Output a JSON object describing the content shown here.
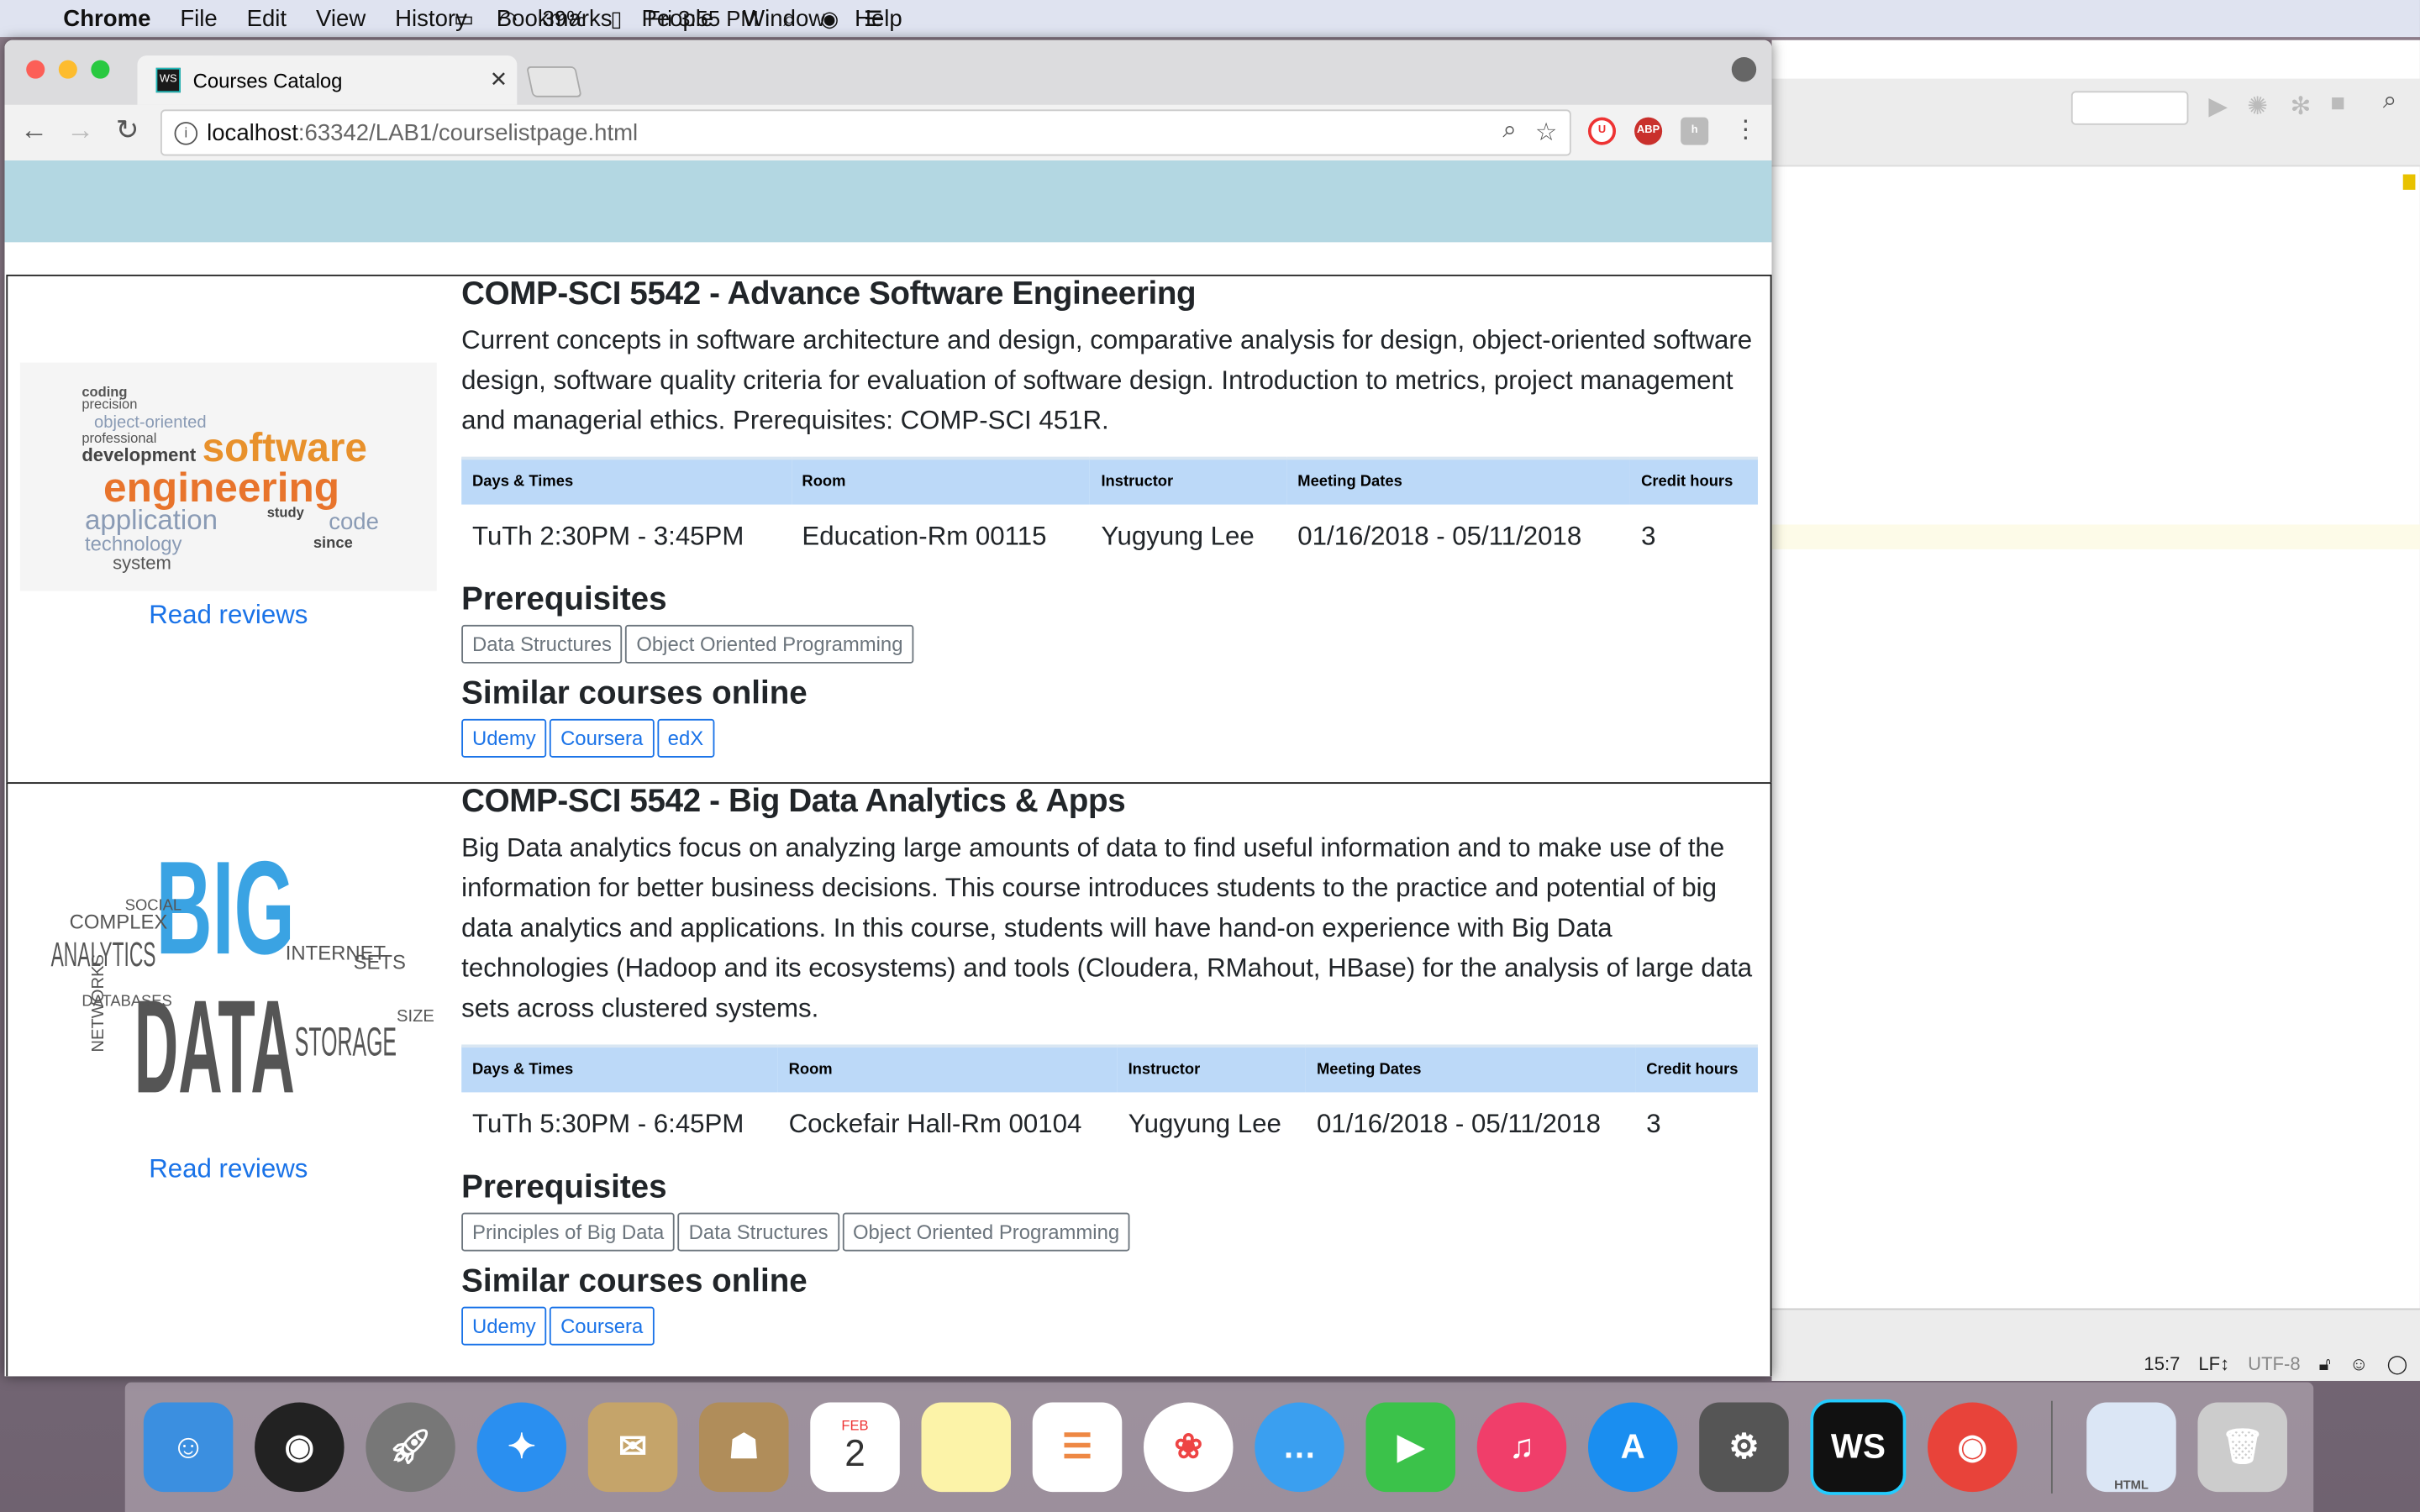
{
  "menubar": {
    "app": "Chrome",
    "items": [
      "File",
      "Edit",
      "View",
      "History",
      "Bookmarks",
      "People",
      "Window",
      "Help"
    ],
    "battery": "39%",
    "clock": "Fri 3:55 PM"
  },
  "browser": {
    "tab_title": "Courses Catalog",
    "url_host": "localhost",
    "url_path": ":63342/LAB1/courselistpage.html",
    "ext_abp": "ABP"
  },
  "courses": [
    {
      "title": "COMP-SCI 5542 - Advance Software Engineering",
      "description": "Current concepts in software architecture and design, comparative analysis for design, object-oriented software design, software quality criteria for evaluation of software design. Introduction to metrics, project management and managerial ethics. Prerequisites: COMP-SCI 451R.",
      "read_reviews": "Read reviews",
      "headers": [
        "Days & Times",
        "Room",
        "Instructor",
        "Meeting Dates",
        "Credit hours"
      ],
      "row": [
        "TuTh 2:30PM - 3:45PM",
        "Education-Rm 00115",
        "Yugyung Lee",
        "01/16/2018 - 05/11/2018",
        "3"
      ],
      "prereq_label": "Prerequisites",
      "prereqs": [
        "Data Structures",
        "Object Oriented Programming"
      ],
      "similar_label": "Similar courses online",
      "similar": [
        "Udemy",
        "Coursera",
        "edX"
      ],
      "image_words": [
        "software",
        "engineering",
        "application",
        "development",
        "technology",
        "system",
        "coding",
        "code",
        "object-oriented",
        "professional",
        "precision",
        "study",
        "since"
      ]
    },
    {
      "title": "COMP-SCI 5542 - Big Data Analytics & Apps",
      "description": "Big Data analytics focus on analyzing large amounts of data to find useful information and to make use of the information for better business decisions. This course introduces students to the practice and potential of big data analytics and applications. In this course, students will have hand-on experience with Big Data technologies (Hadoop and its ecosystems) and tools (Cloudera, RMahout, HBase) for the analysis of large data sets across clustered systems.",
      "read_reviews": "Read reviews",
      "headers": [
        "Days & Times",
        "Room",
        "Instructor",
        "Meeting Dates",
        "Credit hours"
      ],
      "row": [
        "TuTh 5:30PM - 6:45PM",
        "Cockefair Hall-Rm 00104",
        "Yugyung Lee",
        "01/16/2018 - 05/11/2018",
        "3"
      ],
      "prereq_label": "Prerequisites",
      "prereqs": [
        "Principles of Big Data",
        "Data Structures",
        "Object Oriented Programming"
      ],
      "similar_label": "Similar courses online",
      "similar": [
        "Udemy",
        "Coursera"
      ],
      "image_words": [
        "BIG",
        "DATA",
        "ANALYTICS",
        "STORAGE",
        "COMPLEX",
        "INTERNET",
        "SOCIAL",
        "DATABASES",
        "NETWORKS",
        "SETS",
        "SIZE"
      ]
    }
  ],
  "ide_status": {
    "position": "15:7",
    "line_ending": "LF↕",
    "encoding": "UTF-8"
  },
  "dock": {
    "calendar_month": "FEB",
    "calendar_day": "2",
    "webstorm": "WS",
    "html_doc": "HTML"
  }
}
